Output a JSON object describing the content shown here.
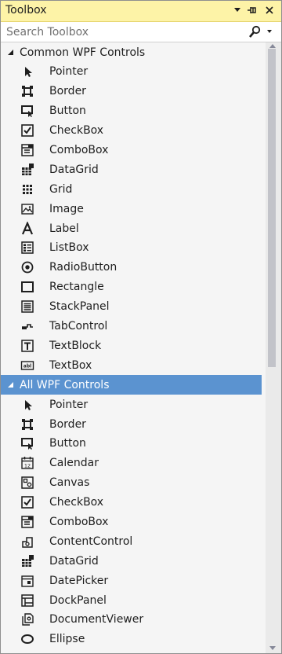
{
  "window": {
    "title": "Toolbox"
  },
  "search": {
    "placeholder": "Search Toolbox"
  },
  "groups": [
    {
      "label": "Common WPF Controls",
      "selected": false,
      "items": [
        {
          "label": "Pointer",
          "icon": "pointer-icon"
        },
        {
          "label": "Border",
          "icon": "border-icon"
        },
        {
          "label": "Button",
          "icon": "button-icon"
        },
        {
          "label": "CheckBox",
          "icon": "checkbox-icon"
        },
        {
          "label": "ComboBox",
          "icon": "combobox-icon"
        },
        {
          "label": "DataGrid",
          "icon": "datagrid-icon"
        },
        {
          "label": "Grid",
          "icon": "grid-icon"
        },
        {
          "label": "Image",
          "icon": "image-icon"
        },
        {
          "label": "Label",
          "icon": "label-icon"
        },
        {
          "label": "ListBox",
          "icon": "listbox-icon"
        },
        {
          "label": "RadioButton",
          "icon": "radiobutton-icon"
        },
        {
          "label": "Rectangle",
          "icon": "rectangle-icon"
        },
        {
          "label": "StackPanel",
          "icon": "stackpanel-icon"
        },
        {
          "label": "TabControl",
          "icon": "tabcontrol-icon"
        },
        {
          "label": "TextBlock",
          "icon": "textblock-icon"
        },
        {
          "label": "TextBox",
          "icon": "textbox-icon"
        }
      ]
    },
    {
      "label": "All WPF Controls",
      "selected": true,
      "items": [
        {
          "label": "Pointer",
          "icon": "pointer-icon"
        },
        {
          "label": "Border",
          "icon": "border-icon"
        },
        {
          "label": "Button",
          "icon": "button-icon"
        },
        {
          "label": "Calendar",
          "icon": "calendar-icon"
        },
        {
          "label": "Canvas",
          "icon": "canvas-icon"
        },
        {
          "label": "CheckBox",
          "icon": "checkbox-icon"
        },
        {
          "label": "ComboBox",
          "icon": "combobox-icon"
        },
        {
          "label": "ContentControl",
          "icon": "contentcontrol-icon"
        },
        {
          "label": "DataGrid",
          "icon": "datagrid-icon"
        },
        {
          "label": "DatePicker",
          "icon": "datepicker-icon"
        },
        {
          "label": "DockPanel",
          "icon": "dockpanel-icon"
        },
        {
          "label": "DocumentViewer",
          "icon": "documentviewer-icon"
        },
        {
          "label": "Ellipse",
          "icon": "ellipse-icon"
        }
      ]
    }
  ],
  "colors": {
    "title_bg": "#fdf3a7",
    "selection_bg": "#5b93d0",
    "panel_bg": "#f5f5f5",
    "text": "#1e1e1e"
  }
}
